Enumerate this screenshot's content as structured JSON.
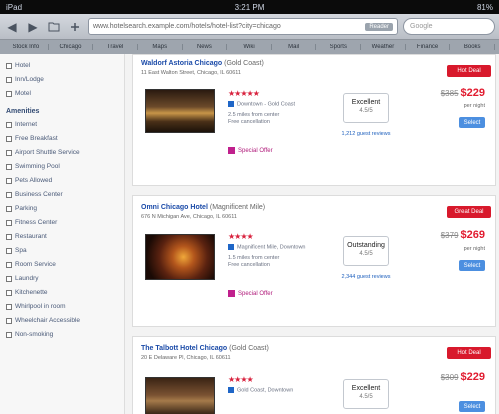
{
  "status": {
    "left": "iPad",
    "time": "3:21 PM",
    "right": "81%"
  },
  "toolbar": {
    "back": "◀",
    "forward": "▶",
    "bookmarks_icon": "bookmarks-icon",
    "url": "www.hotelsearch.example.com/hotels/hotel-list?city=chicago",
    "go_label": "Reader",
    "search_placeholder": "Google"
  },
  "bookmarks": [
    "Stock Info",
    "Chicago",
    "Travel",
    "Maps",
    "News",
    "Wiki",
    "Mail",
    "Sports",
    "Weather",
    "Finance",
    "Books"
  ],
  "sidebar": {
    "top_items": [
      "Hotel",
      "Inn/Lodge",
      "Motel"
    ],
    "amenities_head": "Amenities",
    "amenities": [
      "Internet",
      "Free Breakfast",
      "Airport Shuttle Service",
      "Swimming Pool",
      "Pets Allowed",
      "Business Center",
      "Parking",
      "Fitness Center",
      "Restaurant",
      "Spa",
      "Room Service",
      "Laundry",
      "Kitchenette",
      "Whirlpool in room",
      "Wheelchair Accessible",
      "Non-smoking"
    ]
  },
  "hotels": [
    {
      "name": "Waldorf Astoria Chicago",
      "sub": "(Gold Coast)",
      "desc": "11 East Walton Street, Chicago, IL 60611",
      "stars": "★★★★★",
      "map": "Downtown - Gold Coast",
      "detail1": "2.5 miles from center",
      "detail2": "Free cancellation",
      "promo": "Special Offer",
      "rating_label": "Excellent",
      "rating_score": "4.5/5",
      "reviews": "1,212 guest reviews",
      "badge": "Hot Deal",
      "old_price": "$385",
      "price": "$229",
      "per": "per night",
      "select": "Select"
    },
    {
      "name": "Omni Chicago Hotel",
      "sub": "(Magnificent Mile)",
      "desc": "676 N Michigan Ave, Chicago, IL 60611",
      "stars": "★★★★",
      "map": "Magnificent Mile, Downtown",
      "detail1": "1.5 miles from center",
      "detail2": "Free cancellation",
      "promo": "Special Offer",
      "rating_label": "Outstanding",
      "rating_score": "4.5/5",
      "reviews": "2,344 guest reviews",
      "badge": "Great Deal",
      "old_price": "$379",
      "price": "$269",
      "per": "per night",
      "select": "Select"
    },
    {
      "name": "The Talbott Hotel Chicago",
      "sub": "(Gold Coast)",
      "desc": "20 E Delaware Pl, Chicago, IL 60611",
      "stars": "★★★★",
      "map": "Gold Coast, Downtown",
      "detail1": "",
      "detail2": "",
      "promo": "",
      "rating_label": "Excellent",
      "rating_score": "4.5/5",
      "reviews": "",
      "badge": "Hot Deal",
      "old_price": "$309",
      "price": "$229",
      "per": "",
      "select": "Select"
    }
  ]
}
